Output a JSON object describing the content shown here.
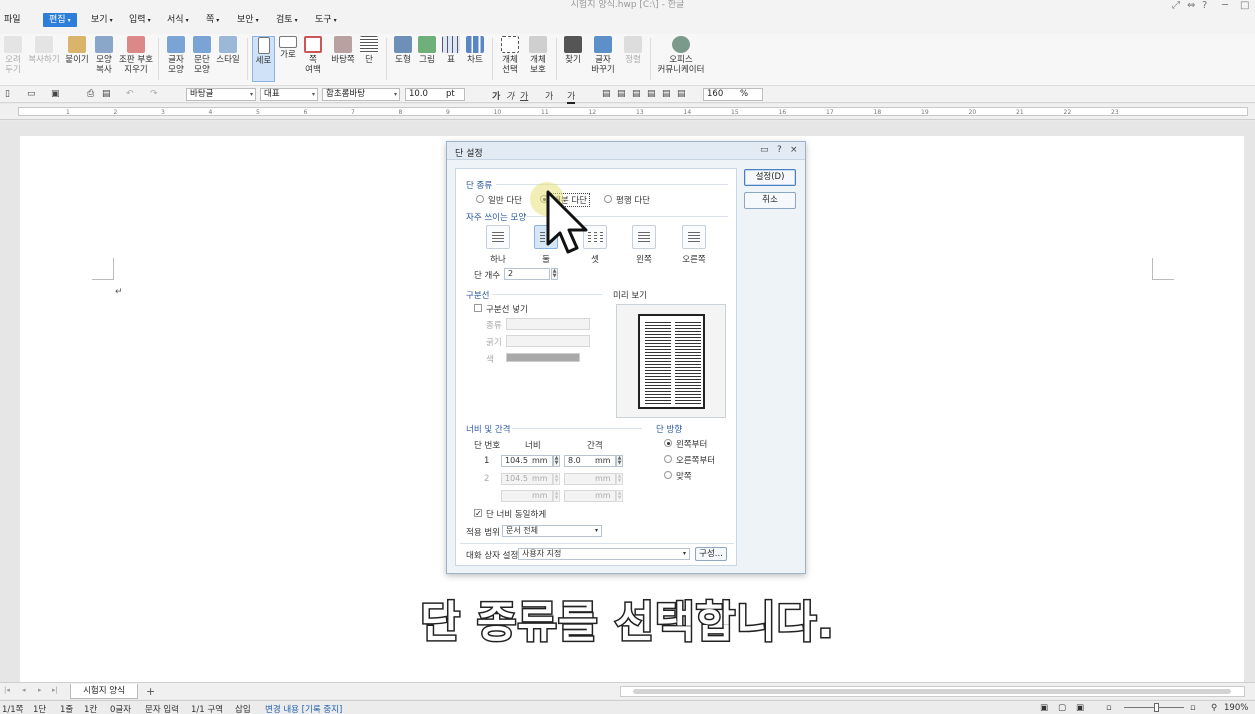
{
  "window": {
    "title": "시험지 양식.hwp [C:\\] - 한글",
    "controls": [
      "⤢",
      "⇔",
      "?",
      "─",
      "□"
    ]
  },
  "menu": {
    "file": "파일",
    "items": [
      "편집",
      "보기",
      "입력",
      "서식",
      "쪽",
      "보안",
      "검토",
      "도구"
    ],
    "active": "편집"
  },
  "ribbon": {
    "items": [
      {
        "label": "오려\n두기",
        "icon": "scissors-icon",
        "disabled": true
      },
      {
        "label": "복사하기",
        "icon": "copy-icon",
        "disabled": true
      },
      {
        "label": "붙이기",
        "icon": "paste-icon"
      },
      {
        "label": "모양\n복사",
        "icon": "format-painter-icon"
      },
      {
        "label": "조판 부호\n지우기",
        "icon": "clear-codes-icon"
      },
      {
        "label": "글자\n모양",
        "icon": "char-shape-icon"
      },
      {
        "label": "문단\n모양",
        "icon": "para-shape-icon"
      },
      {
        "label": "스타일",
        "icon": "style-icon"
      },
      {
        "label": "세로",
        "icon": "portrait-icon",
        "selected": true
      },
      {
        "label": "가로",
        "icon": "landscape-icon"
      },
      {
        "label": "쪽\n여백",
        "icon": "margin-icon"
      },
      {
        "label": "바탕쪽",
        "icon": "master-page-icon"
      },
      {
        "label": "단",
        "icon": "columns-icon"
      },
      {
        "label": "도형",
        "icon": "shape-icon"
      },
      {
        "label": "그림",
        "icon": "picture-icon"
      },
      {
        "label": "표",
        "icon": "table-icon"
      },
      {
        "label": "차트",
        "icon": "chart-icon"
      },
      {
        "label": "개체\n선택",
        "icon": "select-object-icon"
      },
      {
        "label": "개체\n보호",
        "icon": "protect-object-icon"
      },
      {
        "label": "찾기",
        "icon": "find-icon"
      },
      {
        "label": "글자\n바꾸기",
        "icon": "replace-icon"
      },
      {
        "label": "정렬",
        "icon": "sort-icon",
        "disabled": true
      },
      {
        "label": "오피스\n커뮤니케이터",
        "icon": "communicator-icon"
      }
    ]
  },
  "format_toolbar": {
    "style": "바탕글",
    "lang": "대표",
    "font": "함초롬바탕",
    "size": "10.0",
    "size_unit": "pt",
    "zoom": "160",
    "zoom_unit": "%"
  },
  "ruler": {
    "ticks": [
      "1",
      "2",
      "3",
      "4",
      "5",
      "6",
      "7",
      "8",
      "9",
      "10",
      "11",
      "12",
      "13",
      "14",
      "15",
      "16",
      "17",
      "18",
      "19",
      "20",
      "21",
      "22",
      "23"
    ]
  },
  "dialog": {
    "title": "단 설정",
    "help": "?",
    "close": "×",
    "ok_button": "설정(D)",
    "cancel_button": "취소",
    "column_type": {
      "heading": "단 종류",
      "options": [
        "일반 다단",
        "배분 다단",
        "평행 다단"
      ],
      "selected": "배분 다단"
    },
    "presets": {
      "heading": "자주 쓰이는 모양",
      "items": [
        "하나",
        "둘",
        "셋",
        "왼쪽",
        "오른쪽"
      ],
      "selected": "둘"
    },
    "count": {
      "label": "단 개수",
      "value": "2"
    },
    "divider": {
      "heading": "구분선",
      "checkbox": "구분선 넣기",
      "checked": false,
      "type_label": "종류",
      "thickness_label": "굵기",
      "color_label": "색"
    },
    "preview": {
      "heading": "미리 보기"
    },
    "width_spacing": {
      "heading": "너비 및 간격",
      "col_no": "단 번호",
      "width": "너비",
      "gap": "간격",
      "rows": [
        {
          "no": "1",
          "width": "104.5",
          "unit": "mm",
          "gap": "8.0",
          "gap_unit": "mm"
        },
        {
          "no": "2",
          "width": "104.5",
          "unit": "mm",
          "gap": "",
          "gap_unit": "mm"
        },
        {
          "no": "",
          "width": "",
          "unit": "mm",
          "gap": "",
          "gap_unit": "mm"
        }
      ],
      "equal_width": "단 너비 동일하게",
      "equal_checked": true
    },
    "direction": {
      "heading": "단 방향",
      "options": [
        "왼쪽부터",
        "오른쪽부터",
        "맞쪽"
      ],
      "selected": "왼쪽부터"
    },
    "apply": {
      "label": "적용 범위",
      "value": "문서 전체"
    },
    "preset_dialog": {
      "label": "대화 상자 설정",
      "value": "사용자 지정",
      "button": "구성..."
    }
  },
  "subtitle": "단 종류를 선택합니다.",
  "sheet_tabs": {
    "active": "시험지 양식",
    "add": "+"
  },
  "statusbar": {
    "items": [
      "1/1쪽",
      "1단",
      "1줄",
      "1칸",
      "0글자",
      "문자 입력",
      "1/1 구역",
      "삽입",
      "변경 내용 [기록 중지]"
    ],
    "zoom": "190%"
  }
}
